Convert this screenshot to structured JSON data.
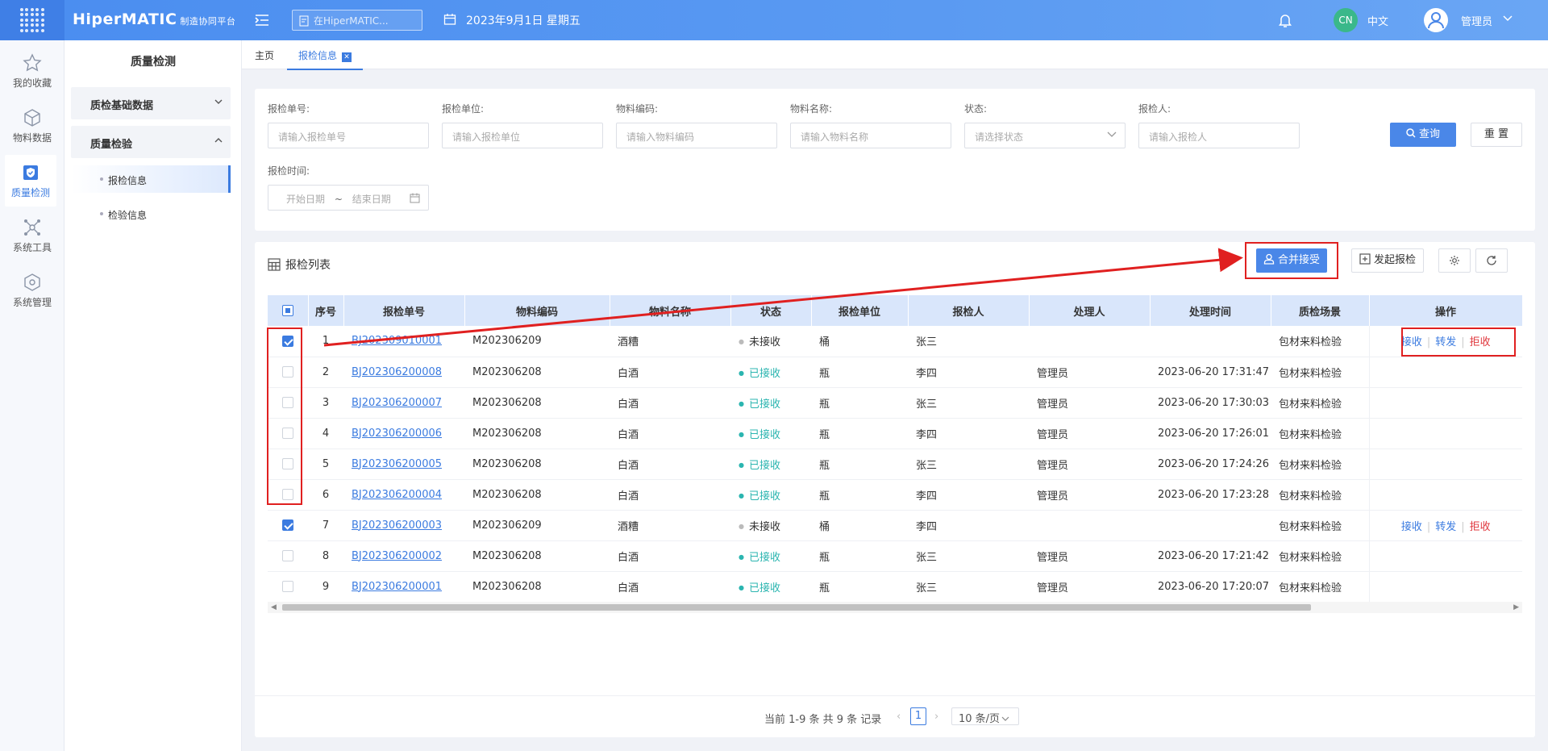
{
  "header": {
    "brand": "HiperMATIC",
    "brand_sub": "制造协同平台",
    "search_placeholder": "在HiperMATIC...",
    "date": "2023年9月1日 星期五",
    "lang_badge": "CN",
    "lang_label": "中文",
    "user": "管理员"
  },
  "rail": [
    {
      "label": "我的收藏",
      "icon": "star-icon"
    },
    {
      "label": "物料数据",
      "icon": "cube-icon"
    },
    {
      "label": "质量检测",
      "icon": "shield-check-icon"
    },
    {
      "label": "系统工具",
      "icon": "network-icon"
    },
    {
      "label": "系统管理",
      "icon": "settings-cube-icon"
    }
  ],
  "submenu": {
    "title": "质量检测",
    "groups": [
      {
        "label": "质检基础数据"
      },
      {
        "label": "质量检验"
      }
    ],
    "items": [
      {
        "label": "报检信息"
      },
      {
        "label": "检验信息"
      }
    ]
  },
  "tabs": [
    {
      "label": "主页"
    },
    {
      "label": "报检信息"
    }
  ],
  "filters": {
    "fields": [
      {
        "label": "报检单号:",
        "placeholder": "请输入报检单号"
      },
      {
        "label": "报检单位:",
        "placeholder": "请输入报检单位"
      },
      {
        "label": "物料编码:",
        "placeholder": "请输入物料编码"
      },
      {
        "label": "物料名称:",
        "placeholder": "请输入物料名称"
      },
      {
        "label": "状态:",
        "placeholder": "请选择状态"
      },
      {
        "label": "报检人:",
        "placeholder": "请输入报检人"
      }
    ],
    "date_label": "报检时间:",
    "date_start": "开始日期",
    "date_sep": "~",
    "date_end": "结束日期",
    "query": "查询",
    "reset": "重 置"
  },
  "list": {
    "title": "报检列表",
    "merge": "合并接受",
    "launch": "发起报检",
    "columns": [
      "序号",
      "报检单号",
      "物料编码",
      "物料名称",
      "状态",
      "报检单位",
      "报检人",
      "处理人",
      "处理时间",
      "质检场景",
      "操作"
    ],
    "rows": [
      {
        "checked": true,
        "no": "1",
        "code": "BJ202309010001",
        "mat": "M202306209",
        "name": "酒糟",
        "status": "未接收",
        "ok": false,
        "unit": "桶",
        "person": "张三",
        "handler": "",
        "time": "",
        "scene": "包材来料检验",
        "ops": true
      },
      {
        "checked": false,
        "no": "2",
        "code": "BJ202306200008",
        "mat": "M202306208",
        "name": "白酒",
        "status": "已接收",
        "ok": true,
        "unit": "瓶",
        "person": "李四",
        "handler": "管理员",
        "time": "2023-06-20 17:31:47",
        "scene": "包材来料检验",
        "ops": false
      },
      {
        "checked": false,
        "no": "3",
        "code": "BJ202306200007",
        "mat": "M202306208",
        "name": "白酒",
        "status": "已接收",
        "ok": true,
        "unit": "瓶",
        "person": "张三",
        "handler": "管理员",
        "time": "2023-06-20 17:30:03",
        "scene": "包材来料检验",
        "ops": false
      },
      {
        "checked": false,
        "no": "4",
        "code": "BJ202306200006",
        "mat": "M202306208",
        "name": "白酒",
        "status": "已接收",
        "ok": true,
        "unit": "瓶",
        "person": "李四",
        "handler": "管理员",
        "time": "2023-06-20 17:26:01",
        "scene": "包材来料检验",
        "ops": false
      },
      {
        "checked": false,
        "no": "5",
        "code": "BJ202306200005",
        "mat": "M202306208",
        "name": "白酒",
        "status": "已接收",
        "ok": true,
        "unit": "瓶",
        "person": "张三",
        "handler": "管理员",
        "time": "2023-06-20 17:24:26",
        "scene": "包材来料检验",
        "ops": false
      },
      {
        "checked": false,
        "no": "6",
        "code": "BJ202306200004",
        "mat": "M202306208",
        "name": "白酒",
        "status": "已接收",
        "ok": true,
        "unit": "瓶",
        "person": "李四",
        "handler": "管理员",
        "time": "2023-06-20 17:23:28",
        "scene": "包材来料检验",
        "ops": false
      },
      {
        "checked": true,
        "no": "7",
        "code": "BJ202306200003",
        "mat": "M202306209",
        "name": "酒糟",
        "status": "未接收",
        "ok": false,
        "unit": "桶",
        "person": "李四",
        "handler": "",
        "time": "",
        "scene": "包材来料检验",
        "ops": true
      },
      {
        "checked": false,
        "no": "8",
        "code": "BJ202306200002",
        "mat": "M202306208",
        "name": "白酒",
        "status": "已接收",
        "ok": true,
        "unit": "瓶",
        "person": "张三",
        "handler": "管理员",
        "time": "2023-06-20 17:21:42",
        "scene": "包材来料检验",
        "ops": false
      },
      {
        "checked": false,
        "no": "9",
        "code": "BJ202306200001",
        "mat": "M202306208",
        "name": "白酒",
        "status": "已接收",
        "ok": true,
        "unit": "瓶",
        "person": "张三",
        "handler": "管理员",
        "time": "2023-06-20 17:20:07",
        "scene": "包材来料检验",
        "ops": false
      }
    ],
    "op_accept": "接收",
    "op_forward": "转发",
    "op_reject": "拒收"
  },
  "pager": {
    "info": "当前 1-9 条 共 9 条 记录",
    "page": "1",
    "size": "10 条/页"
  },
  "colors": {
    "primary": "#4a87e8",
    "highlight": "#e02020",
    "ok": "#2bb5b0"
  }
}
